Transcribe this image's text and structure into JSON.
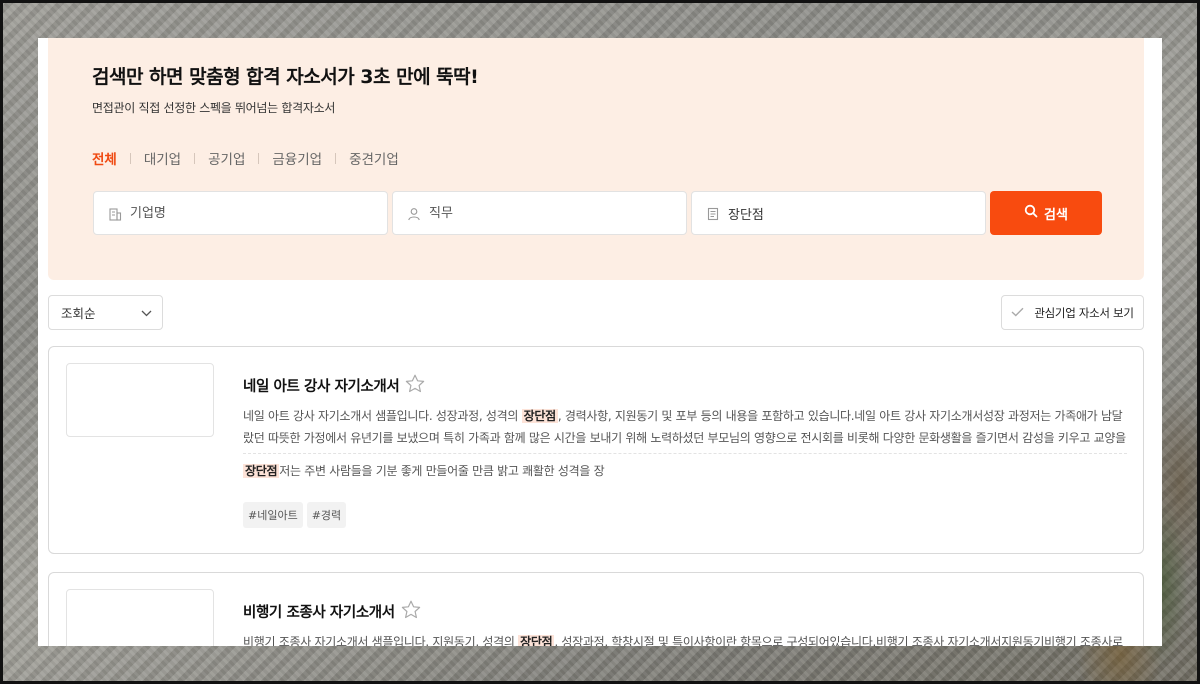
{
  "hero": {
    "title": "검색만 하면 맞춤형 합격 자소서가 3초 만에 뚝딱!",
    "subtitle": "면접관이 직접 선정한 스펙을 뛰어넘는 합격자소서",
    "categories": [
      {
        "label": "전체",
        "active": true
      },
      {
        "label": "대기업",
        "active": false
      },
      {
        "label": "공기업",
        "active": false
      },
      {
        "label": "금융기업",
        "active": false
      },
      {
        "label": "중견기업",
        "active": false
      }
    ]
  },
  "search": {
    "company_placeholder": "기업명",
    "job_placeholder": "직무",
    "keyword_value": "장단점",
    "button_label": "검색"
  },
  "toolbar": {
    "sort_selected": "조회순",
    "fav_label": "관심기업 자소서 보기"
  },
  "results": [
    {
      "title": "네일 아트 강사 자기소개서",
      "desc_before": "네일 아트 강사 자기소개서 샘플입니다. 성장과정, 성격의 ",
      "desc_highlight": "장단점",
      "desc_after": ", 경력사항, 지원동기 및 포부 등의 내용을 포함하고 있습니다.네일 아트 강사 자기소개서성장 과정저는 가족애가 남달랐던 따뜻한 가정에서 유년기를 보냈으며 특히 가족과 함께 많은 시간을 보내기 위해 노력하셨던 부모님의 영향으로 전시회를 비롯해 다양한 문화생활을 즐기면서 감성을 키우고 교양을 ...",
      "snippet_highlight": "장단점",
      "snippet_after": "저는 주변 사람들을 기분 좋게 만들어줄 만큼 밝고 쾌활한 성격을 장",
      "tags": [
        "#네일아트",
        "#경력"
      ]
    },
    {
      "title": "비행기 조종사 자기소개서",
      "desc_before": "비행기 조종사 자기소개서 샘플입니다. 지원동기, 성격의 ",
      "desc_highlight": "장단점",
      "desc_after": ", 성장과정, 학창시절 및 특이사항이란 항목으로 구성되어있습니다.비행기 조종사 자기소개서지원동기비행기 조종사로"
    }
  ],
  "colors": {
    "accent": "#f84b0f",
    "hero_bg": "#fdeee4",
    "highlight_bg": "#fde3d8"
  }
}
